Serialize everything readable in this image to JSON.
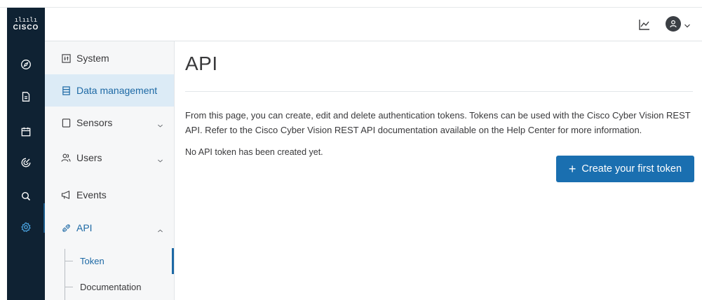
{
  "brand": {
    "logo_bars": "ılıılı",
    "logo_word": "CISCO"
  },
  "rail": {
    "items": [
      {
        "name": "explore-icon"
      },
      {
        "name": "reports-icon"
      },
      {
        "name": "events-icon"
      },
      {
        "name": "monitor-icon"
      },
      {
        "name": "search-icon"
      },
      {
        "name": "settings-icon"
      }
    ]
  },
  "header": {
    "icons": [
      "chart-icon",
      "user-avatar-icon",
      "chevron-down-icon"
    ]
  },
  "subnav": {
    "items": [
      {
        "label": "System",
        "icon": "system-icon"
      },
      {
        "label": "Data management",
        "icon": "database-icon",
        "active": true
      },
      {
        "label": "Sensors",
        "icon": "sensor-icon",
        "expandable": true
      },
      {
        "label": "Users",
        "icon": "users-icon",
        "expandable": true
      },
      {
        "label": "Events",
        "icon": "megaphone-icon"
      },
      {
        "label": "API",
        "icon": "api-icon",
        "expanded": true
      }
    ],
    "api_children": [
      {
        "label": "Token",
        "active": true
      },
      {
        "label": "Documentation"
      }
    ]
  },
  "main": {
    "title": "API",
    "description": "From this page, you can create, edit and delete authentication tokens. Tokens can be used with the Cisco Cyber Vision REST API. Refer to the Cisco Cyber Vision REST API documentation available on the Help Center for more information.",
    "empty_state": "No API token has been created yet.",
    "create_button": {
      "icon": "+",
      "label": "Create your first token"
    }
  },
  "colors": {
    "rail_bg": "#0f2233",
    "accent": "#1d69a5",
    "button": "#1a6fb0",
    "active_bg": "#dcebf6"
  }
}
